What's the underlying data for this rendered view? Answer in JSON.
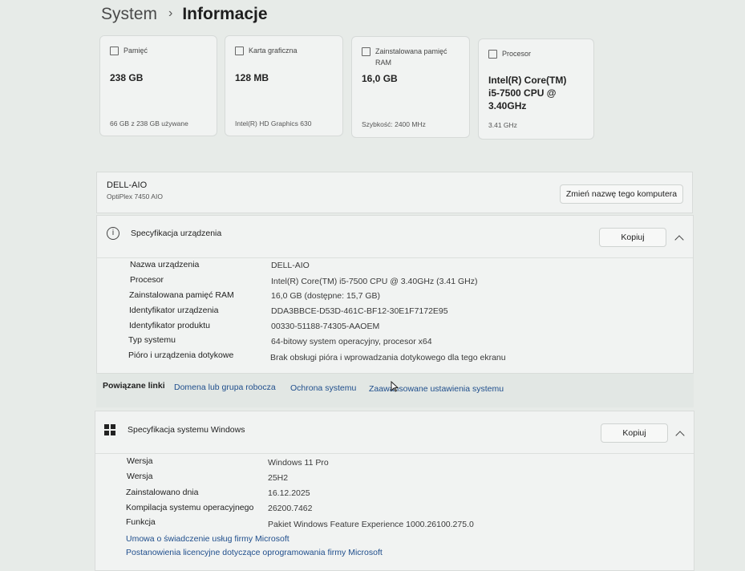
{
  "breadcrumb": {
    "parent": "System",
    "separator": "›",
    "current": "Informacje"
  },
  "cards": [
    {
      "title": "Pamięć",
      "value": "238 GB",
      "sub": "66 GB z 238 GB używane",
      "icon": "storage-icon"
    },
    {
      "title": "Karta graficzna",
      "value": "128 MB",
      "sub": "Intel(R) HD Graphics 630",
      "icon": "gpu-icon"
    },
    {
      "title_line1": "Zainstalowana pamięć",
      "title_line2": "RAM",
      "value": "16,0 GB",
      "sub": "Szybkość: 2400 MHz",
      "icon": "ram-icon"
    },
    {
      "title": "Procesor",
      "value_line1": "Intel(R) Core(TM)",
      "value_line2": "i5-7500 CPU @",
      "value_line3": "3.40GHz",
      "sub": "3.41 GHz",
      "icon": "cpu-icon"
    }
  ],
  "device": {
    "name": "DELL-AIO",
    "model": "OptiPlex 7450 AIO",
    "rename_label": "Zmień nazwę tego komputera"
  },
  "device_spec": {
    "title": "Specyfikacja urządzenia",
    "copy_label": "Kopiuj",
    "rows": [
      {
        "label": "Nazwa urządzenia",
        "value": "DELL-AIO"
      },
      {
        "label": "Procesor",
        "value": "Intel(R) Core(TM) i5-7500 CPU @ 3.40GHz (3.41 GHz)"
      },
      {
        "label": "Zainstalowana pamięć RAM",
        "value": "16,0 GB (dostępne: 15,7 GB)"
      },
      {
        "label": "Identyfikator urządzenia",
        "value": "DDA3BBCE-D53D-461C-BF12-30E1F7172E95"
      },
      {
        "label": "Identyfikator produktu",
        "value": "00330-51188-74305-AAOEM"
      },
      {
        "label": "Typ systemu",
        "value": "64-bitowy system operacyjny, procesor x64"
      },
      {
        "label": "Pióro i urządzenia dotykowe",
        "value": "Brak obsługi pióra i wprowadzania dotykowego dla tego ekranu"
      }
    ]
  },
  "related": {
    "label": "Powiązane linki",
    "links": [
      "Domena lub grupa robocza",
      "Ochrona systemu",
      "Zaawansowane ustawienia systemu"
    ]
  },
  "windows_spec": {
    "title": "Specyfikacja systemu Windows",
    "copy_label": "Kopiuj",
    "rows": [
      {
        "label": "Wersja",
        "value": "Windows 11 Pro"
      },
      {
        "label": "Wersja",
        "value": "25H2"
      },
      {
        "label": "Zainstalowano dnia",
        "value": "16.12.2025"
      },
      {
        "label": "Kompilacja systemu operacyjnego",
        "value": "26200.7462"
      },
      {
        "label": "Funkcja",
        "value": "Pakiet Windows Feature Experience 1000.26100.275.0"
      }
    ],
    "links": [
      "Umowa o świadczenie usług firmy Microsoft",
      "Postanowienia licencyjne dotyczące oprogramowania firmy Microsoft"
    ]
  }
}
